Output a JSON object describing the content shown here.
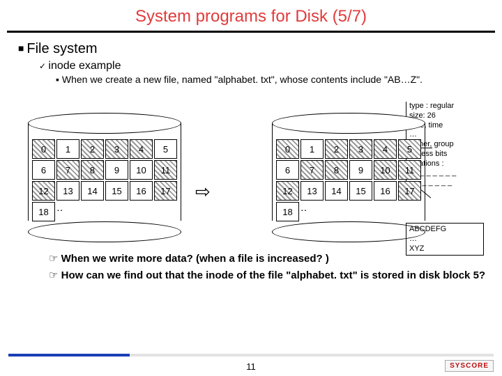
{
  "title": "System programs for Disk (5/7)",
  "bullets": {
    "l1": "File system",
    "l2": "inode example",
    "l3": "When we create a new file, named \"alphabet. txt\", whose contents include \"AB…Z\"."
  },
  "disk_left": {
    "used": [
      0,
      2,
      3,
      4,
      7,
      8,
      11,
      12,
      17
    ],
    "free": [
      1,
      5,
      6,
      9,
      10,
      13,
      14,
      15,
      16,
      18
    ],
    "rows": [
      [
        "0",
        "1",
        "2",
        "3",
        "4",
        "5"
      ],
      [
        "6",
        "7",
        "8",
        "9",
        "10",
        "11"
      ],
      [
        "12",
        "13",
        "14",
        "15",
        "16",
        "17"
      ],
      [
        "18",
        "‥",
        "",
        "",
        "",
        ""
      ]
    ]
  },
  "disk_right": {
    "used": [
      0,
      2,
      3,
      4,
      5,
      7,
      8,
      10,
      11,
      12,
      17
    ],
    "free": [
      1,
      6,
      9,
      13,
      14,
      15,
      16,
      18
    ],
    "rows": [
      [
        "0",
        "1",
        "2",
        "3",
        "4",
        "5"
      ],
      [
        "6",
        "7",
        "8",
        "9",
        "10",
        "11"
      ],
      [
        "12",
        "13",
        "14",
        "15",
        "16",
        "17"
      ],
      [
        "18",
        "‥",
        "",
        "",
        "",
        ""
      ]
    ]
  },
  "inode": {
    "l1": "type : regular",
    "l2": "size: 26",
    "l3": "date, time",
    "l4": "…",
    "l5": "owner, group",
    "l6": "access bits",
    "l7": "locations :",
    "l8": "10 _ _ _ _ _ _",
    "l9": "_ _ _ _ _ _ _"
  },
  "block17": {
    "l1": "ABCDEFG",
    "l2": "…",
    "l3": "XYZ"
  },
  "arrow": "⇨",
  "q1": "When we write more data? (when a file is increased? )",
  "q2": "How can we find out that the inode of the file \"alphabet. txt\" is stored in disk block 5?",
  "pagenum": "11",
  "logo": "SYSCORE"
}
